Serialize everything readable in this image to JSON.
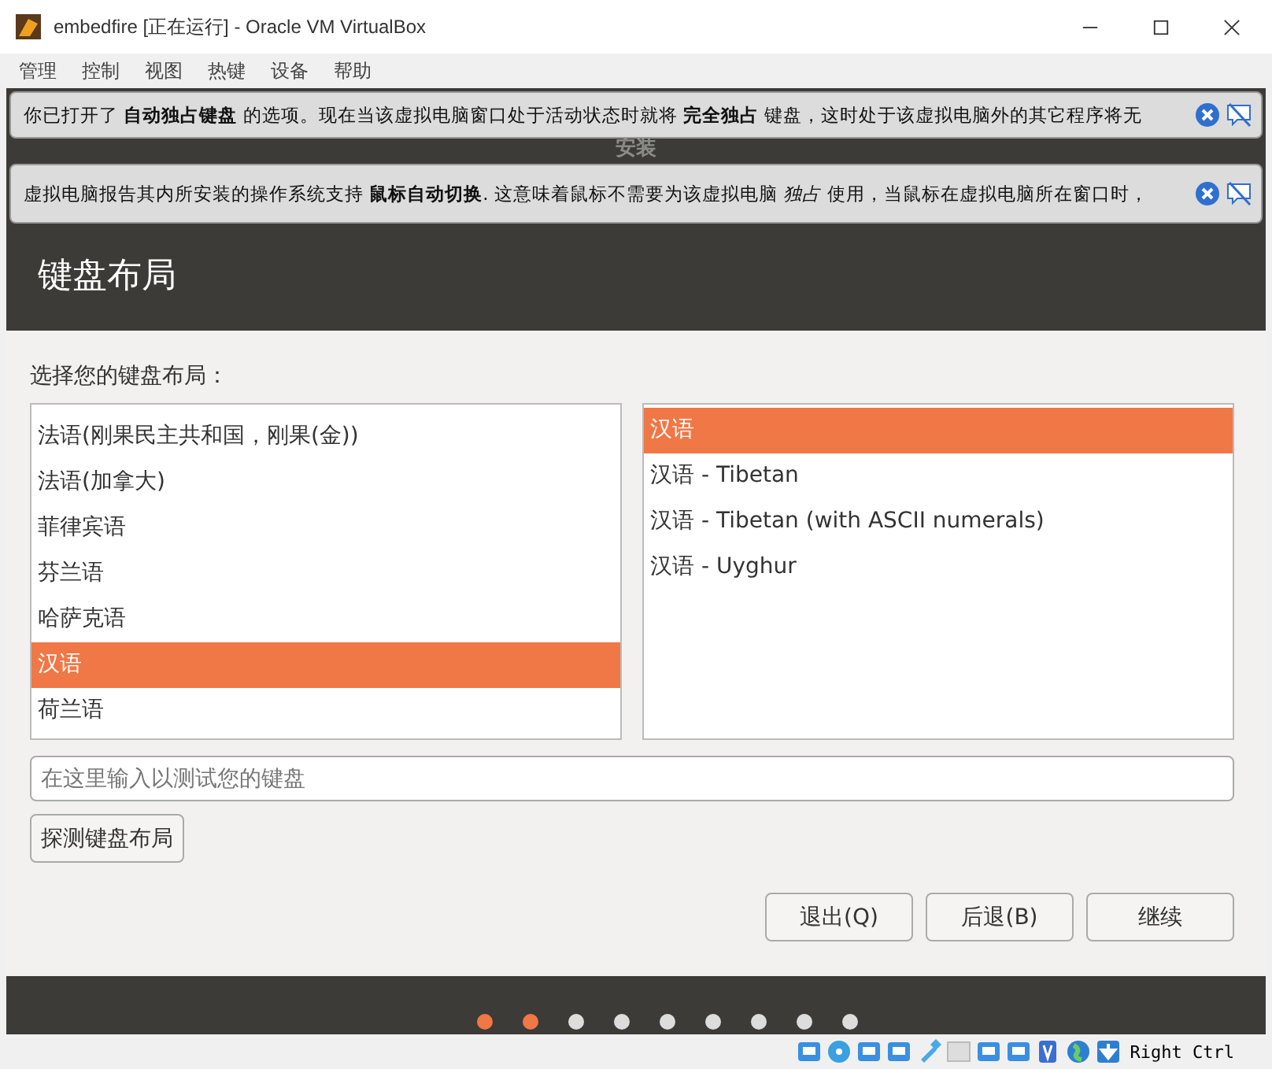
{
  "window": {
    "title": "embedfire [正在运行] - Oracle VM VirtualBox"
  },
  "menu": [
    "管理",
    "控制",
    "视图",
    "热键",
    "设备",
    "帮助"
  ],
  "notices": [
    {
      "text": "你已打开了 **自动独占键盘** 的选项。现在当该虚拟电脑窗口处于活动状态时就将 **完全独占** 键盘，这时处于该虚拟电脑外的其它程序将无"
    },
    {
      "text": "虚拟电脑报告其内所安装的操作系统支持 **鼠标自动切换**. 这意味着鼠标不需要为该虚拟电脑 *独占* 使用，当鼠标在虚拟电脑所在窗口时，"
    }
  ],
  "installer": {
    "title": "安装",
    "heading": "键盘布局",
    "prompt": "选择您的键盘布局：",
    "layouts": [
      {
        "label": "法语(刚果民主共和国，刚果(金))",
        "selected": false
      },
      {
        "label": "法语(加拿大)",
        "selected": false
      },
      {
        "label": "菲律宾语",
        "selected": false
      },
      {
        "label": "芬兰语",
        "selected": false
      },
      {
        "label": "哈萨克语",
        "selected": false
      },
      {
        "label": "汉语",
        "selected": true
      },
      {
        "label": "荷兰语",
        "selected": false
      }
    ],
    "variants": [
      {
        "label": "汉语",
        "selected": true
      },
      {
        "label": "汉语 - Tibetan",
        "selected": false
      },
      {
        "label": "汉语 - Tibetan (with ASCII numerals)",
        "selected": false
      },
      {
        "label": "汉语 - Uyghur",
        "selected": false
      }
    ],
    "test_field": {
      "placeholder": "在这里输入以测试您的键盘"
    },
    "detect_button": "探测键盘布局",
    "buttons": [
      "退出(Q)",
      "后退(B)",
      "继续"
    ],
    "steps": [
      {
        "done": true
      },
      {
        "done": true
      },
      {
        "done": false
      },
      {
        "done": false
      },
      {
        "done": false
      },
      {
        "done": false
      },
      {
        "done": false
      },
      {
        "done": false
      },
      {
        "done": false
      }
    ]
  },
  "status_bar": {
    "host_key": "Right Ctrl"
  }
}
